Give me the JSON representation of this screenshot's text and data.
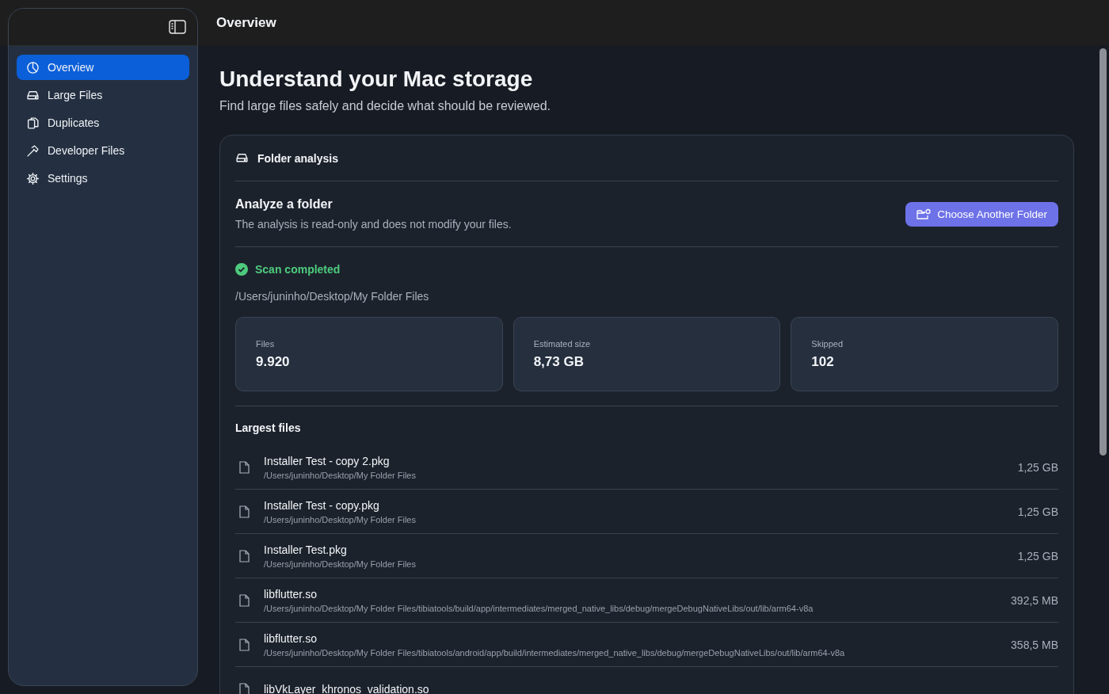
{
  "toolbar": {
    "title": "Overview"
  },
  "sidebar": {
    "items": [
      {
        "label": "Overview",
        "selected": true
      },
      {
        "label": "Large Files",
        "selected": false
      },
      {
        "label": "Duplicates",
        "selected": false
      },
      {
        "label": "Developer Files",
        "selected": false
      },
      {
        "label": "Settings",
        "selected": false
      }
    ]
  },
  "page": {
    "title": "Understand your Mac storage",
    "subtitle": "Find large files safely and decide what should be reviewed."
  },
  "card": {
    "title": "Folder analysis",
    "analyze": {
      "title": "Analyze a folder",
      "description": "The analysis is read-only and does not modify your files.",
      "button": "Choose Another Folder"
    },
    "status": {
      "label": "Scan completed",
      "path": "/Users/juninho/Desktop/My Folder Files"
    },
    "stats": [
      {
        "label": "Files",
        "value": "9.920"
      },
      {
        "label": "Estimated size",
        "value": "8,73 GB"
      },
      {
        "label": "Skipped",
        "value": "102"
      }
    ],
    "largest_files": {
      "title": "Largest files",
      "rows": [
        {
          "name": "Installer Test - copy 2.pkg",
          "path": "/Users/juninho/Desktop/My Folder Files",
          "size": "1,25 GB"
        },
        {
          "name": "Installer Test - copy.pkg",
          "path": "/Users/juninho/Desktop/My Folder Files",
          "size": "1,25 GB"
        },
        {
          "name": "Installer Test.pkg",
          "path": "/Users/juninho/Desktop/My Folder Files",
          "size": "1,25 GB"
        },
        {
          "name": "libflutter.so",
          "path": "/Users/juninho/Desktop/My Folder Files/tibiatools/build/app/intermediates/merged_native_libs/debug/mergeDebugNativeLibs/out/lib/arm64-v8a",
          "size": "392,5 MB"
        },
        {
          "name": "libflutter.so",
          "path": "/Users/juninho/Desktop/My Folder Files/tibiatools/android/app/build/intermediates/merged_native_libs/debug/mergeDebugNativeLibs/out/lib/arm64-v8a",
          "size": "358,5 MB"
        },
        {
          "name": "libVkLayer_khronos_validation.so"
        }
      ]
    }
  }
}
